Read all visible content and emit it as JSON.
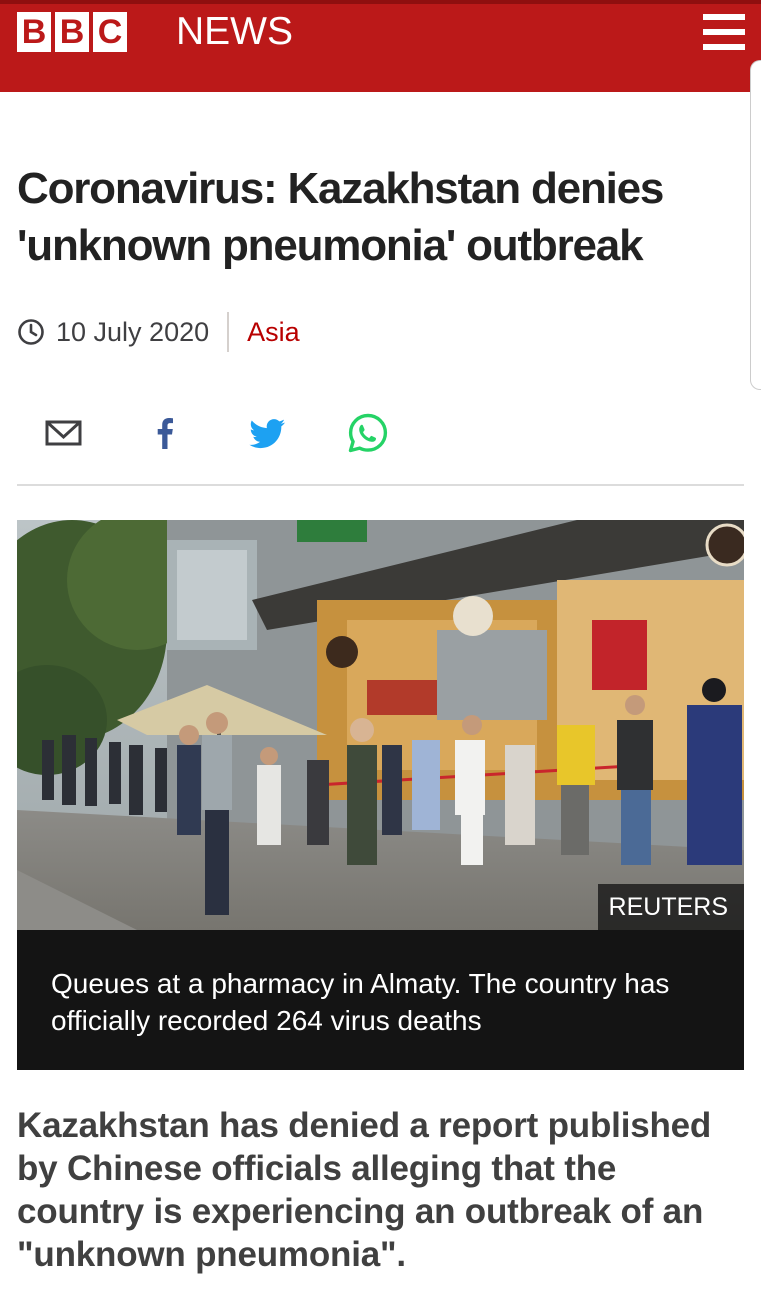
{
  "masthead": {
    "brand_letters": [
      "B",
      "B",
      "C"
    ],
    "brand_word": "NEWS",
    "brand_color": "#bb1919",
    "menu_icon": "hamburger-icon"
  },
  "article": {
    "headline": "Coronavirus: Kazakhstan denies 'unknown pneumonia' outbreak",
    "date": "10 July 2020",
    "section": "Asia",
    "section_color": "#b80000"
  },
  "share": {
    "icons": [
      "email-icon",
      "facebook-icon",
      "twitter-icon",
      "whatsapp-icon"
    ],
    "colors": {
      "email": "#3f3f42",
      "facebook": "#3b5998",
      "twitter": "#1da1f2",
      "whatsapp": "#25d366"
    }
  },
  "image": {
    "credit": "REUTERS",
    "caption": "Queues at a pharmacy in Almaty. The country has officially recorded 264 virus deaths"
  },
  "body": {
    "lede": "Kazakhstan has denied a report published by Chinese officials alleging that the country is experiencing an outbreak of an \"unknown pneumonia\"."
  }
}
